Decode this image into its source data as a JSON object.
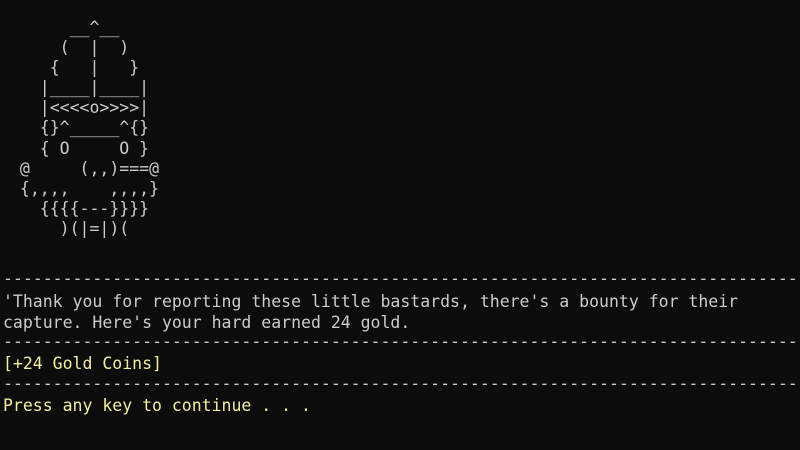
{
  "art": {
    "lines": [
      "      __^__",
      "     (  |  )",
      "    {   |   }",
      "   |____|____|",
      "   |<<<<o>>>>|",
      "   {}^_____^{}",
      "   { O     O }",
      " @     (,,)===@",
      " {,,,,    ,,,,}",
      "   {{{{---}}}}",
      "     )(|=|)("
    ]
  },
  "separators": {
    "line": "----------------------------------------------------------------------------------------------------"
  },
  "dialogue": {
    "line1": "'Thank you for reporting these little bastards, there's a bounty for their",
    "line2": "capture. Here's your hard earned 24 gold."
  },
  "reward": {
    "text": "[+24 Gold Coins]"
  },
  "prompt": {
    "text": "Press any key to continue . . ."
  },
  "colors": {
    "background": "#0c0c0c",
    "text": "#cccccc",
    "highlight": "#f3eea0"
  }
}
